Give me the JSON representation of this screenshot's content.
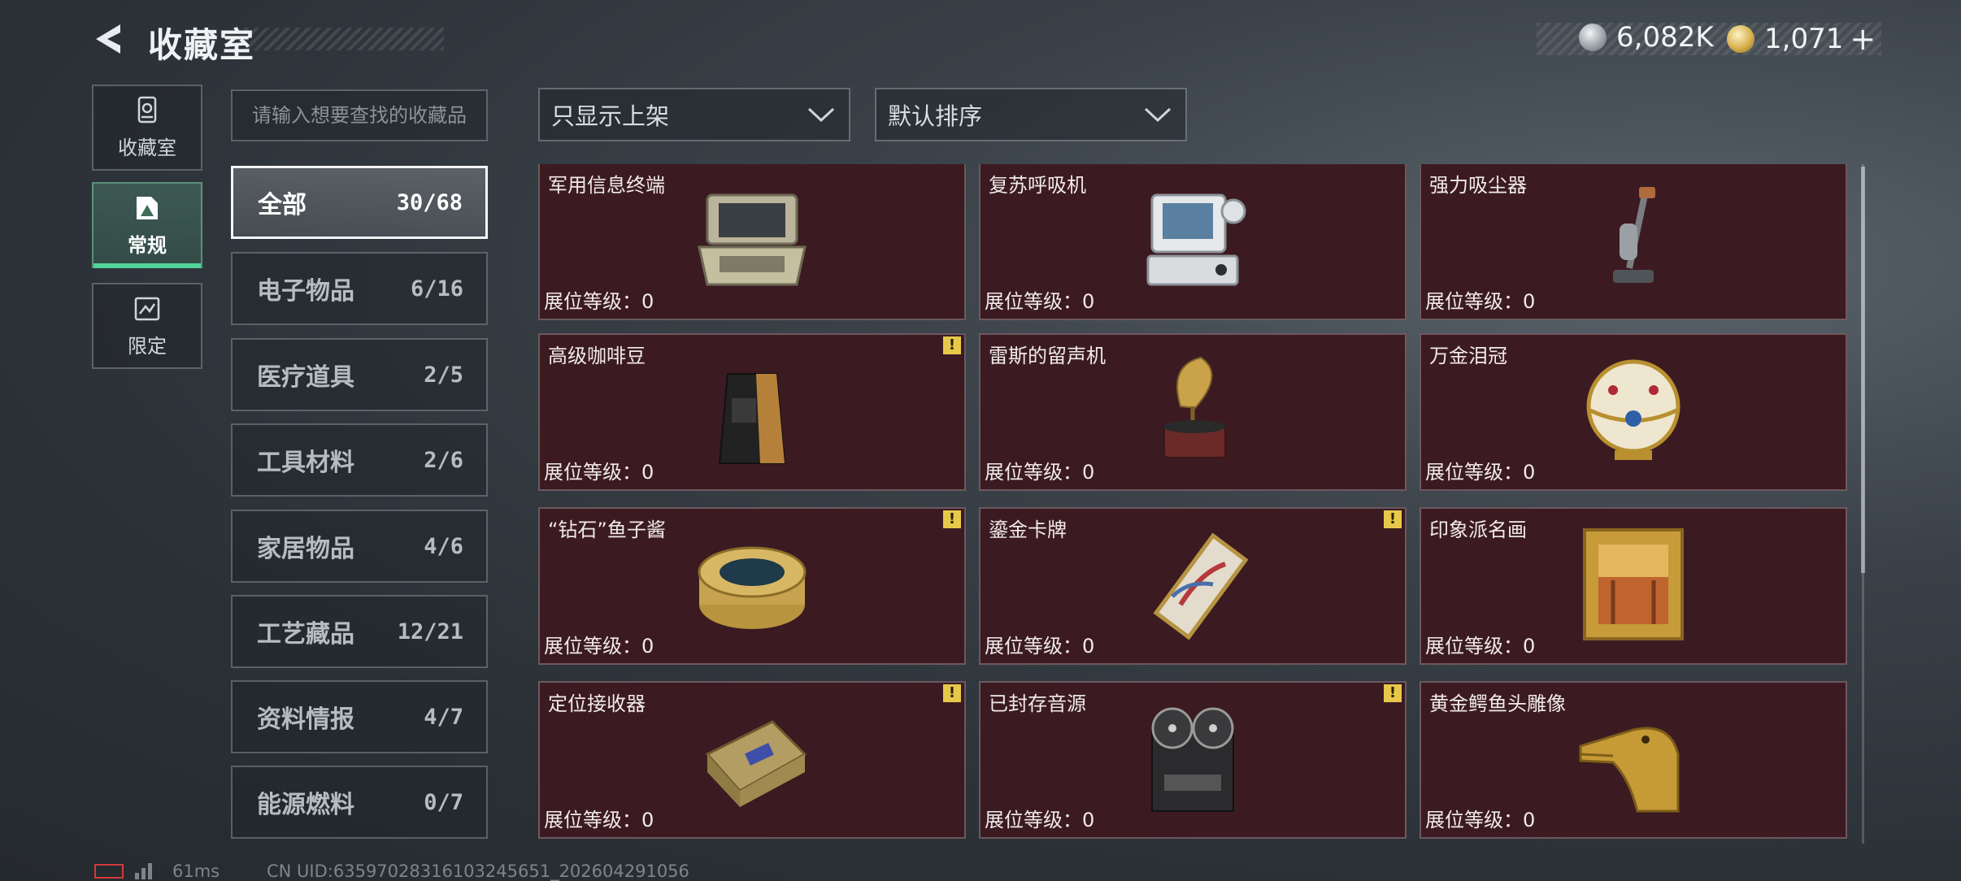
{
  "header": {
    "title": "收藏室",
    "currency_silver": "6,082K",
    "currency_gold": "1,071",
    "currency_plus": "+"
  },
  "nav": [
    {
      "label": "收藏室",
      "icon": "collection-room-icon"
    },
    {
      "label": "常规",
      "icon": "regular-collection-icon",
      "active": true
    },
    {
      "label": "限定",
      "icon": "limited-collection-icon"
    }
  ],
  "search": {
    "placeholder": "请输入想要查找的收藏品",
    "value": ""
  },
  "filters": {
    "display": "只显示上架",
    "sort": "默认排序"
  },
  "categories": [
    {
      "label": "全部",
      "count": "30/68",
      "active": true
    },
    {
      "label": "电子物品",
      "count": "6/16"
    },
    {
      "label": "医疗道具",
      "count": "2/5"
    },
    {
      "label": "工具材料",
      "count": "2/6"
    },
    {
      "label": "家居物品",
      "count": "4/6"
    },
    {
      "label": "工艺藏品",
      "count": "12/21"
    },
    {
      "label": "资料情报",
      "count": "4/7"
    },
    {
      "label": "能源燃料",
      "count": "0/7"
    }
  ],
  "level_label": "展位等级：0",
  "warning_mark": "!",
  "items": [
    {
      "name": "军用信息终端",
      "icon": "military-terminal-icon",
      "warning": false
    },
    {
      "name": "复苏呼吸机",
      "icon": "respirator-icon",
      "warning": false
    },
    {
      "name": "强力吸尘器",
      "icon": "vacuum-cleaner-icon",
      "warning": false
    },
    {
      "name": "高级咖啡豆",
      "icon": "coffee-beans-icon",
      "warning": true
    },
    {
      "name": "雷斯的留声机",
      "icon": "gramophone-icon",
      "warning": false
    },
    {
      "name": "万金泪冠",
      "icon": "jeweled-egg-icon",
      "warning": false
    },
    {
      "name": "“钻石”鱼子酱",
      "icon": "caviar-tin-icon",
      "warning": true
    },
    {
      "name": "鎏金卡牌",
      "icon": "gilded-card-icon",
      "warning": true
    },
    {
      "name": "印象派名画",
      "icon": "framed-painting-icon",
      "warning": false
    },
    {
      "name": "定位接收器",
      "icon": "locator-receiver-icon",
      "warning": true
    },
    {
      "name": "已封存音源",
      "icon": "reel-recorder-icon",
      "warning": true
    },
    {
      "name": "黄金鳄鱼头雕像",
      "icon": "gold-crocodile-statue-icon",
      "warning": false
    }
  ],
  "footer": {
    "latency": "61ms",
    "uid": "CN UID:635970283161032456​51_202604291056"
  }
}
